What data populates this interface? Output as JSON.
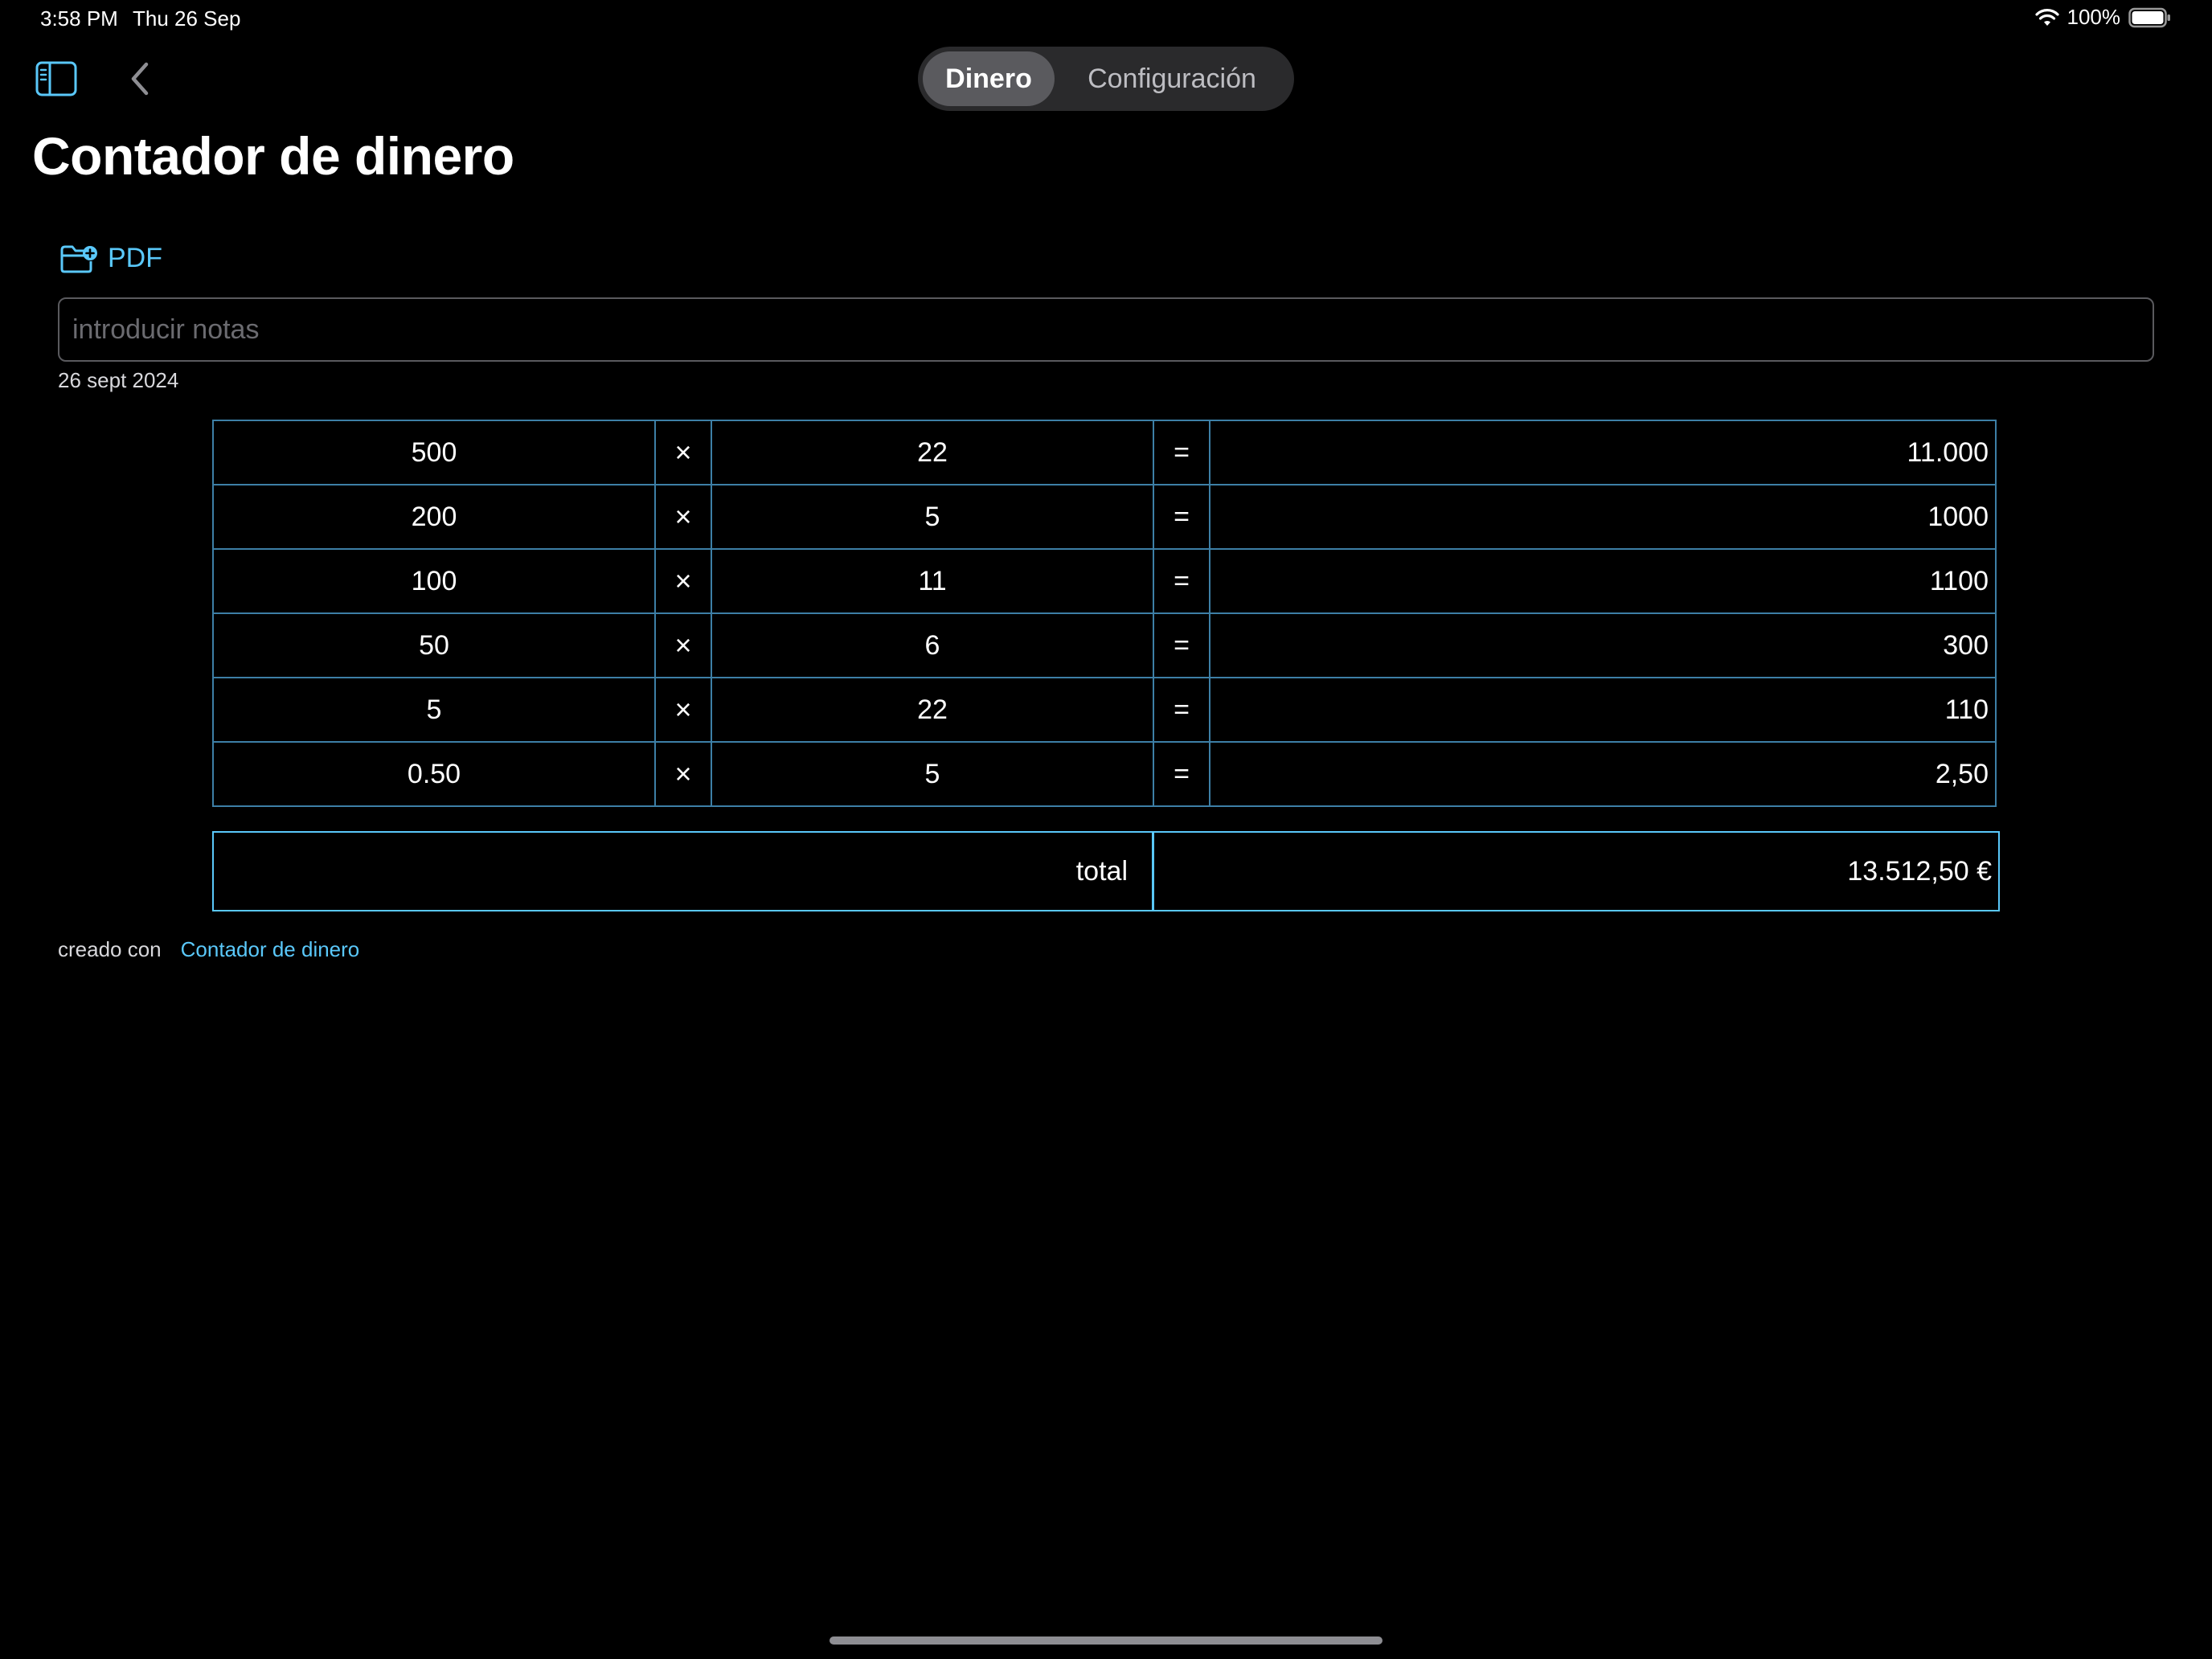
{
  "status_bar": {
    "time": "3:58 PM",
    "date": "Thu 26 Sep",
    "battery": "100%"
  },
  "nav": {
    "segments": [
      {
        "label": "Dinero",
        "active": true
      },
      {
        "label": "Configuración",
        "active": false
      }
    ]
  },
  "page": {
    "title": "Contador de dinero"
  },
  "toolbar": {
    "pdf_label": "PDF"
  },
  "notes": {
    "placeholder": "introducir notas",
    "value": ""
  },
  "date_label": "26 sept 2024",
  "table": {
    "rows": [
      {
        "denomination": "500",
        "op": "×",
        "quantity": "22",
        "eq": "=",
        "result": "11.000"
      },
      {
        "denomination": "200",
        "op": "×",
        "quantity": "5",
        "eq": "=",
        "result": "1000"
      },
      {
        "denomination": "100",
        "op": "×",
        "quantity": "11",
        "eq": "=",
        "result": "1100"
      },
      {
        "denomination": "50",
        "op": "×",
        "quantity": "6",
        "eq": "=",
        "result": "300"
      },
      {
        "denomination": "5",
        "op": "×",
        "quantity": "22",
        "eq": "=",
        "result": "110"
      },
      {
        "denomination": "0.50",
        "op": "×",
        "quantity": "5",
        "eq": "=",
        "result": "2,50"
      }
    ],
    "total_label": "total",
    "total_value": "13.512,50 €"
  },
  "footer": {
    "text": "creado con",
    "link": "Contador de dinero"
  },
  "colors": {
    "accent": "#5ac8fa",
    "cell_border": "#3d7fa6",
    "background": "#000000"
  }
}
